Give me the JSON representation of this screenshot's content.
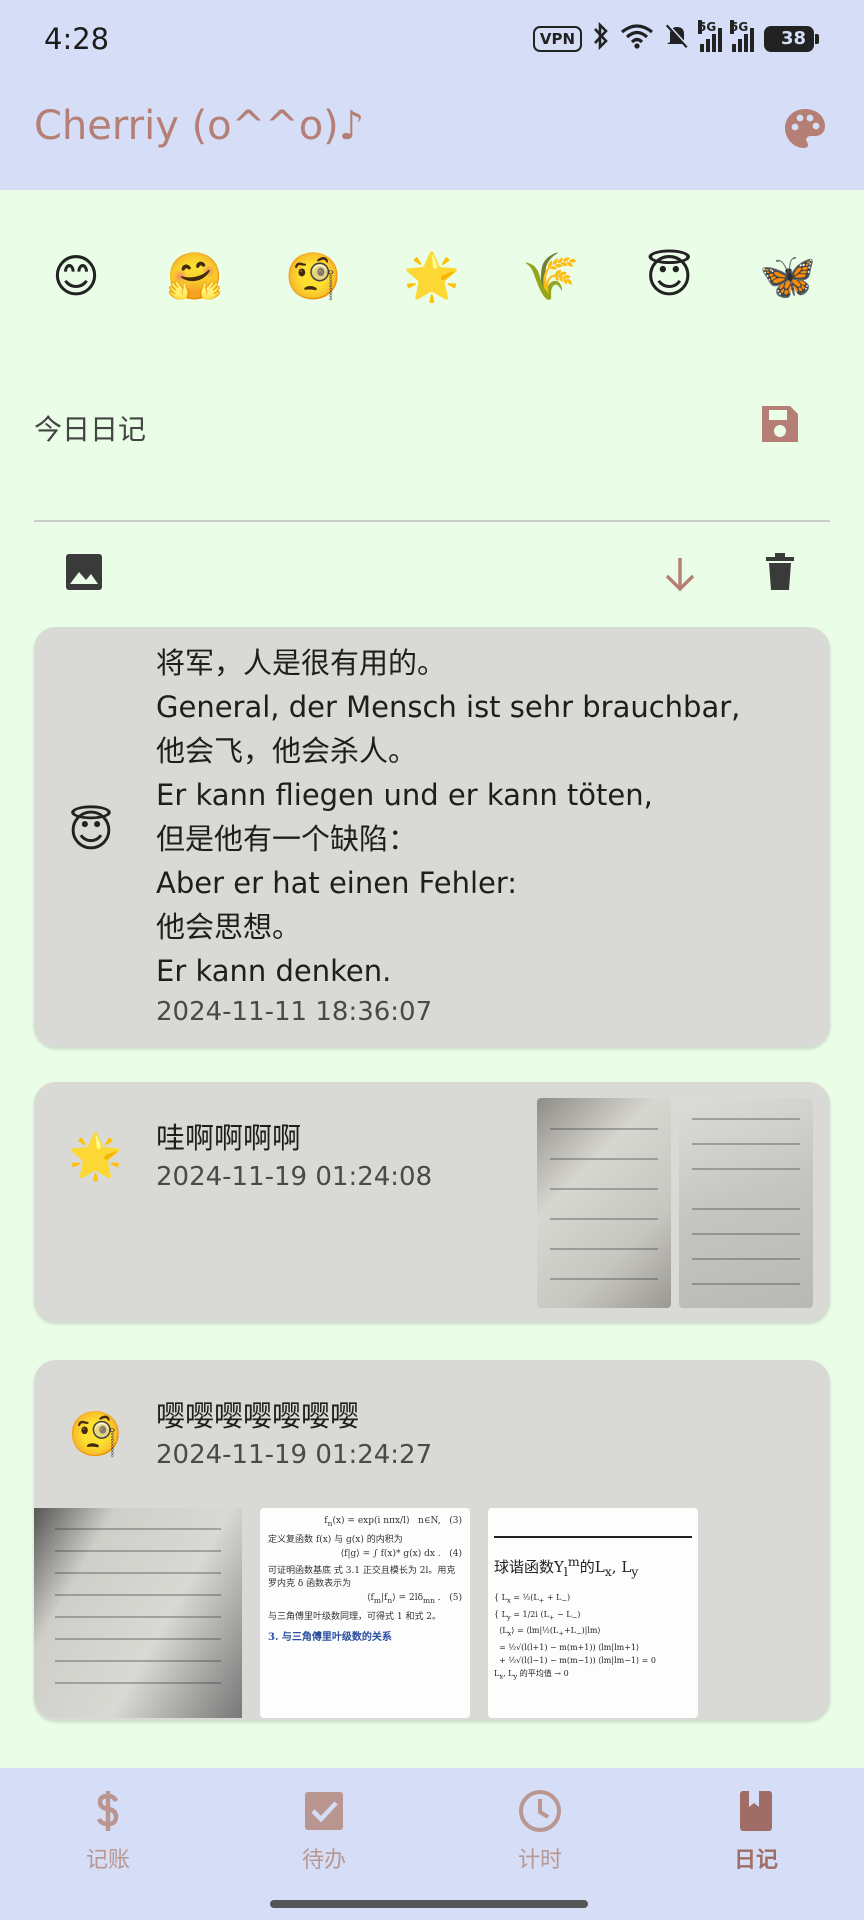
{
  "status_bar": {
    "time": "4:28",
    "vpn": "VPN",
    "net1": "5G",
    "net2": "5G",
    "battery": "38"
  },
  "app_bar": {
    "title": "Cherriy (o^^o)♪",
    "palette_icon": "palette-icon"
  },
  "mood_picker": [
    {
      "emoji": "😊",
      "name": "smiling-face"
    },
    {
      "emoji": "🤗",
      "name": "hugging-face"
    },
    {
      "emoji": "🧐",
      "name": "monocle-face"
    },
    {
      "emoji": "🌟",
      "name": "glowing-star"
    },
    {
      "emoji": "🌾",
      "name": "rice-sheaf"
    },
    {
      "emoji": "😇",
      "name": "halo-face"
    },
    {
      "emoji": "🦋",
      "name": "butterfly"
    }
  ],
  "editor": {
    "placeholder": "今日日记",
    "save_icon": "save-icon",
    "image_icon": "image-icon",
    "download_icon": "arrow-down-icon",
    "delete_icon": "trash-icon"
  },
  "entries": [
    {
      "mood": "😇",
      "text": "将军，人是很有用的。\nGeneral, der Mensch ist sehr brauchbar,\n他会飞，他会杀人。\nEr kann fliegen und er kann töten,\n但是他有一个缺陷：\nAber er hat einen Fehler:\n他会思想。\nEr kann denken.",
      "date": "2024-11-11 18:36:07"
    },
    {
      "mood": "🌟",
      "text": "哇啊啊啊啊",
      "date": "2024-11-19 01:24:08"
    },
    {
      "mood": "🧐",
      "text": "嘤嘤嘤嘤嘤嘤嘤",
      "date": "2024-11-19 01:24:27",
      "thumb_labels": {
        "eq3": "(3)",
        "define": "定义复函数 f(x) 与 g(x) 的内积为",
        "eq4": "(4)",
        "proof": "可证明函数基底 式 3.1 正交且模长为 2l。用克罗内克 δ 函数表示为",
        "eq5": "(5)",
        "relation": "与三角傅里叶级数同理，可得式 1 和式 2。",
        "section": "3. 与三角傅里叶级数的关系",
        "sph_title": "球谐函数Y",
        "sph_title_rest": "的L",
        "sph_note": "的平均值"
      }
    }
  ],
  "bottom_nav": [
    {
      "label": "记账",
      "icon": "dollar-icon"
    },
    {
      "label": "待办",
      "icon": "checkbox-icon"
    },
    {
      "label": "计时",
      "icon": "clock-icon"
    },
    {
      "label": "日记",
      "icon": "book-icon",
      "active": true
    }
  ],
  "colors": {
    "app_bar_bg": "#d5def6",
    "page_bg": "#eafde6",
    "accent": "#b57f75",
    "card_bg": "#d9dad5"
  }
}
